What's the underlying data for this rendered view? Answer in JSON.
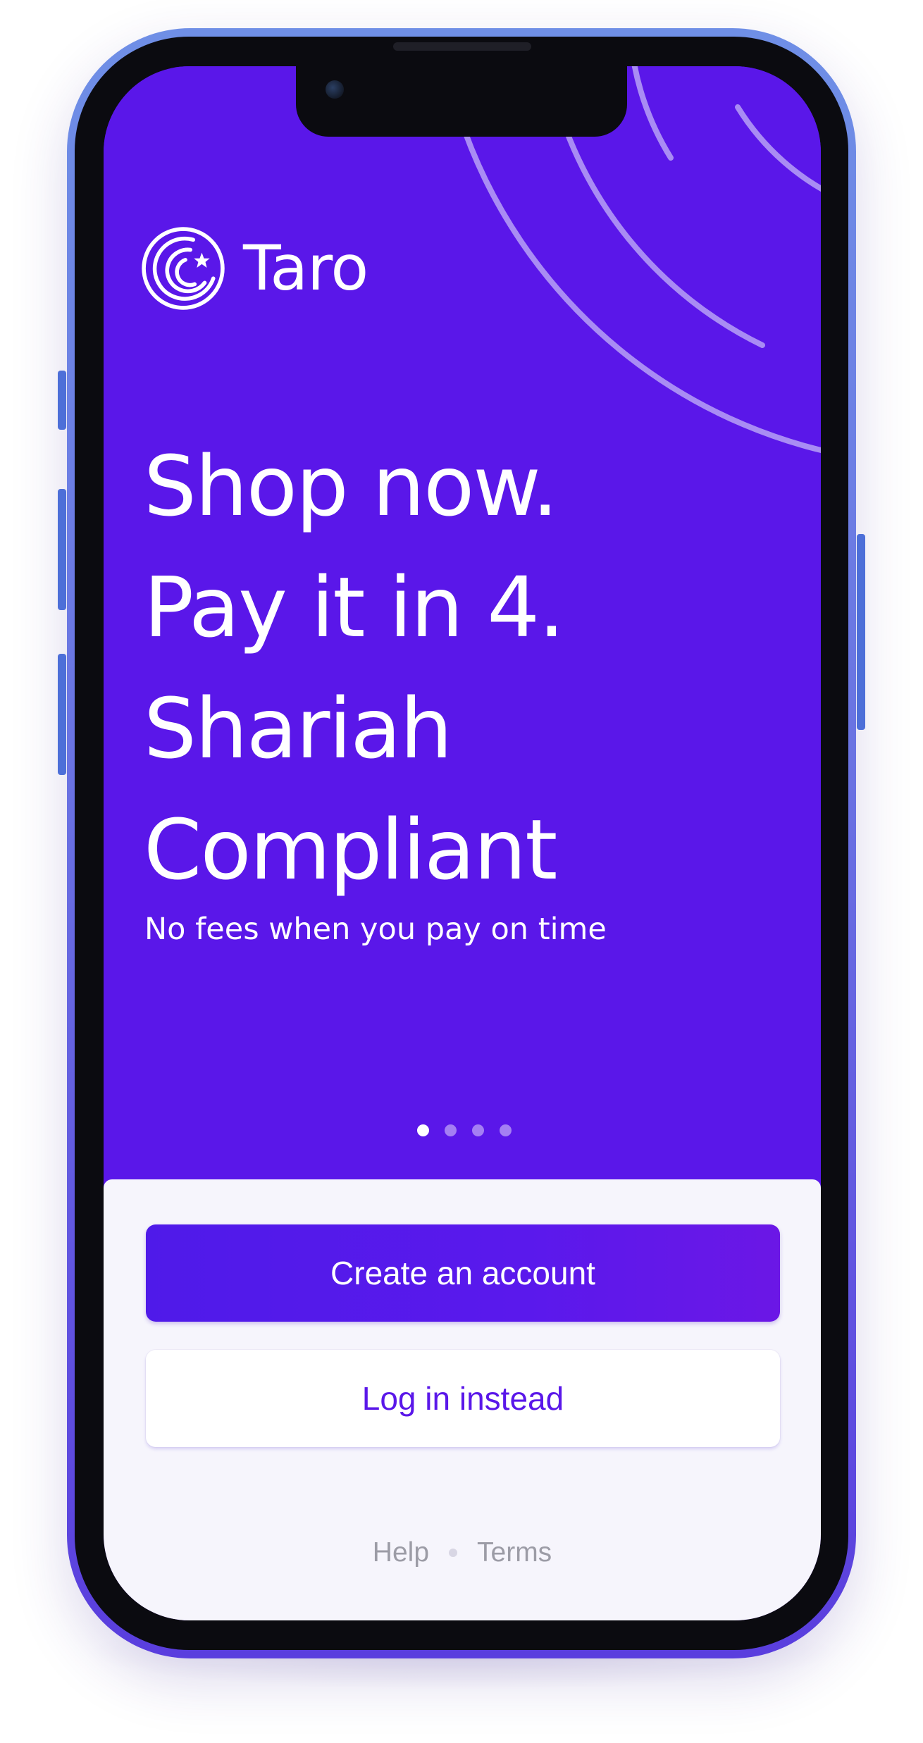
{
  "app": {
    "name": "Taro"
  },
  "onboarding": {
    "headline_lines": [
      "Shop now.",
      "Pay it in 4.",
      "Shariah",
      "Compliant"
    ],
    "subtitle": "No fees when you pay on time",
    "pager": {
      "total": 4,
      "active_index": 0
    }
  },
  "actions": {
    "create_account_label": "Create an account",
    "login_label": "Log in instead"
  },
  "footer": {
    "help_label": "Help",
    "terms_label": "Terms"
  },
  "colors": {
    "brand_purple": "#5a17e9",
    "sheet_background": "#f6f5fc",
    "muted_link": "#9c9ca6"
  },
  "icons": {
    "logo": "crescent-star-logo-icon"
  }
}
